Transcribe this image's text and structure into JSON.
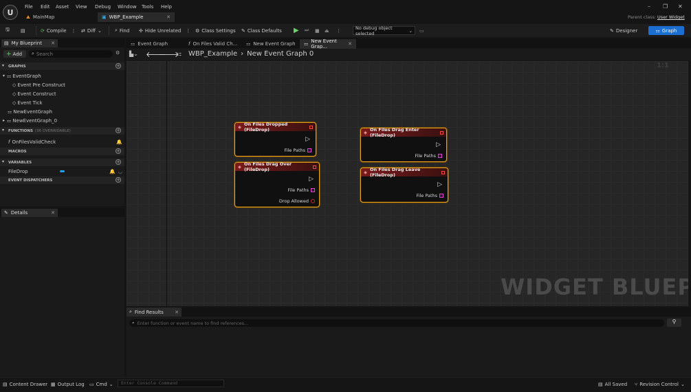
{
  "menu": [
    "File",
    "Edit",
    "Asset",
    "View",
    "Debug",
    "Window",
    "Tools",
    "Help"
  ],
  "tabs": [
    {
      "label": "MainMap"
    },
    {
      "label": "WBP_Example"
    }
  ],
  "parent_class_label": "Parent class:",
  "parent_class_value": "User Widget",
  "toolbar": {
    "compile": "Compile",
    "diff": "Diff",
    "find": "Find",
    "hide_unrelated": "Hide Unrelated",
    "class_settings": "Class Settings",
    "class_defaults": "Class Defaults",
    "debug_object": "No debug object selected",
    "designer": "Designer",
    "graph": "Graph"
  },
  "my_blueprint": {
    "title": "My Blueprint",
    "add": "Add",
    "search_placeholder": "Search"
  },
  "sections": {
    "graphs": "GRAPHS",
    "functions": "FUNCTIONS",
    "functions_note": "(36 OVERRIDABLE)",
    "macros": "MACROS",
    "variables": "VARIABLES",
    "dispatchers": "EVENT DISPATCHERS"
  },
  "graph_items": [
    "EventGraph",
    "Event Pre Construct",
    "Event Construct",
    "Event Tick",
    "NewEventGraph",
    "NewEventGraph_0"
  ],
  "functions": [
    "OnFilesValidCheck"
  ],
  "variables": [
    {
      "name": "FileDrop",
      "type_color": "#1fa0e8"
    }
  ],
  "details": {
    "title": "Details"
  },
  "graph_tabs": [
    "Event Graph",
    "On Files Valid Ch...",
    "New Event Graph",
    "New Event Grap..."
  ],
  "breadcrumb": {
    "root": "WBP_Example",
    "current": "New Event Graph 0"
  },
  "zoom": "Zoom 1:1",
  "watermark": "WIDGET BLUEPRINT",
  "nodes": {
    "files_dropped": {
      "title": "On Files Dropped (FileDrop)",
      "pin1": "File Paths"
    },
    "drag_over": {
      "title": "On Files Drag Over (FileDrop)",
      "pin1": "File Paths",
      "pin2": "Drop Allowed"
    },
    "drag_enter": {
      "title": "On Files Drag Enter (FileDrop)",
      "pin1": "File Paths"
    },
    "drag_leave": {
      "title": "On Files Drag Leave (FileDrop)",
      "pin1": "File Paths"
    }
  },
  "find_results": {
    "title": "Find Results",
    "placeholder": "Enter function or event name to find references..."
  },
  "status": {
    "content_drawer": "Content Drawer",
    "output_log": "Output Log",
    "cmd": "Cmd",
    "console_placeholder": "Enter Console Command",
    "all_saved": "All Saved",
    "revision": "Revision Control"
  }
}
